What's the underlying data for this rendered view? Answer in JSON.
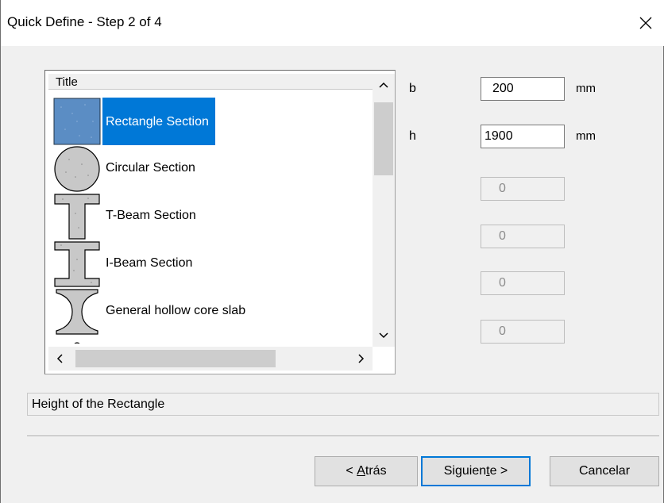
{
  "window": {
    "title": "Quick Define - Step 2 of 4",
    "close_glyph": "✕"
  },
  "list": {
    "header": "Title",
    "items": [
      {
        "label": "Rectangle Section",
        "icon": "rectangle-section-icon",
        "selected": true
      },
      {
        "label": "Circular Section",
        "icon": "circular-section-icon"
      },
      {
        "label": "T-Beam Section",
        "icon": "t-beam-section-icon"
      },
      {
        "label": "I-Beam Section",
        "icon": "i-beam-section-icon"
      },
      {
        "label": "General hollow core slab",
        "icon": "hollow-core-slab-icon"
      }
    ]
  },
  "fields": {
    "b": {
      "label": "b",
      "value": "200",
      "unit": "mm"
    },
    "h": {
      "label": "h",
      "value": "1900",
      "unit": "mm"
    },
    "f3": {
      "value": "0"
    },
    "f4": {
      "value": "0"
    },
    "f5": {
      "value": "0"
    },
    "f6": {
      "value": "0"
    }
  },
  "status": {
    "text": "Height of the Rectangle"
  },
  "buttons": {
    "back_prefix": "< ",
    "back_mnemonic": "A",
    "back_rest": "trás",
    "next_prefix": "Siguien",
    "next_mnemonic": "t",
    "next_rest": "e >",
    "cancel": "Cancelar"
  },
  "colors": {
    "selection": "#0078d7",
    "concrete": "#c8c8c8",
    "selected_thumb": "#5b8dc4"
  }
}
